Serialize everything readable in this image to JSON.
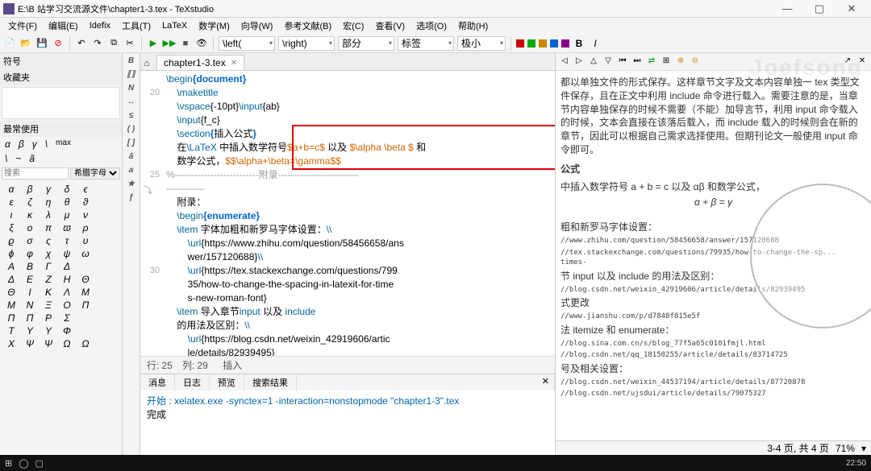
{
  "title": "E:\\B 站学习交流源文件\\chapter1-3.tex - TeXstudio",
  "menus": [
    "文件(F)",
    "编辑(E)",
    "Idefix",
    "工具(T)",
    "LaTeX",
    "数学(M)",
    "向导(W)",
    "参考文献(B)",
    "宏(C)",
    "查看(V)",
    "选项(O)",
    "帮助(H)"
  ],
  "toolbar_dropdowns": [
    "\\left(",
    "\\right)",
    "部分",
    "标签",
    "极小"
  ],
  "left": {
    "symbols_title": "符号",
    "favorites_title": "收藏夹",
    "most_used_title": "最常使用",
    "common1": [
      "α",
      "β",
      "γ",
      "\\",
      "max"
    ],
    "common2": [
      "\\",
      "~",
      "ã"
    ],
    "search_placeholder": "搜索",
    "category": "希腊字母",
    "rows": [
      [
        "α",
        "β",
        "γ",
        "δ",
        "ϵ"
      ],
      [
        "ε",
        "ζ",
        "η",
        "θ",
        "ϑ"
      ],
      [
        "ι",
        "κ",
        "λ",
        "μ",
        "ν"
      ],
      [
        "ξ",
        "ο",
        "π",
        "ϖ",
        "ρ"
      ],
      [
        "ϱ",
        "σ",
        "ς",
        "τ",
        "υ"
      ],
      [
        "ϕ",
        "φ",
        "χ",
        "ψ",
        "ω"
      ],
      [
        "A",
        "B",
        "Γ",
        "Δ",
        ""
      ],
      [
        "Δ",
        "E",
        "Z",
        "H",
        "Θ"
      ],
      [
        "Θ",
        "I",
        "K",
        "Λ",
        "M"
      ],
      [
        "M",
        "N",
        "Ξ",
        "O",
        "Π"
      ],
      [
        "Π",
        "Π",
        "P",
        "Σ",
        ""
      ],
      [
        "T",
        "Υ",
        "Υ",
        "Φ",
        ""
      ],
      [
        "X",
        "Ψ",
        "Ψ",
        "Ω",
        "Ω"
      ]
    ]
  },
  "tab": {
    "name": "chapter1-3.tex"
  },
  "code": {
    "lines": [
      {
        "n": "",
        "t": [
          [
            "cmd",
            "\\begin"
          ],
          [
            "brace",
            "{"
          ],
          [
            "brace",
            "document"
          ],
          [
            "brace",
            "}"
          ]
        ]
      },
      {
        "n": "20",
        "t": [
          [
            "",
            "    "
          ],
          [
            "cmd",
            "\\maketitle"
          ]
        ]
      },
      {
        "n": "",
        "t": [
          [
            "",
            "    "
          ],
          [
            "cmd",
            "\\vspace"
          ],
          [
            "",
            "{-10pt}"
          ],
          [
            "cmd",
            "\\input"
          ],
          [
            "",
            "{ab}"
          ]
        ]
      },
      {
        "n": "",
        "t": [
          [
            "",
            "    "
          ],
          [
            "cmd",
            "\\input"
          ],
          [
            "",
            "{f_c}"
          ]
        ]
      },
      {
        "n": "",
        "t": [
          [
            "",
            "    "
          ],
          [
            "cmd",
            "\\section"
          ],
          [
            "brace",
            "{"
          ],
          [
            "",
            "插入公式"
          ],
          [
            "brace",
            "}"
          ]
        ]
      },
      {
        "n": "",
        "t": [
          [
            "",
            "    在"
          ],
          [
            "cmd",
            "\\LaTeX"
          ],
          [
            "",
            ""
          ],
          [
            "",
            " 中插入数学符号"
          ],
          [
            "math",
            "$a+b=c$"
          ],
          [
            "",
            " 以及 "
          ],
          [
            "math",
            "$\\alpha \\beta $"
          ],
          [
            "",
            " 和"
          ]
        ]
      },
      {
        "n": "",
        "t": [
          [
            "",
            "    数学公式，"
          ],
          [
            "math",
            "$$\\alpha+\\beta=\\gamma$$"
          ]
        ]
      },
      {
        "n": "25",
        "t": [
          [
            "comment",
            "%--------------------------附录-------------------------"
          ]
        ]
      },
      {
        "n": "",
        "t": [
          [
            "comment",
            "------------"
          ]
        ]
      },
      {
        "n": "",
        "t": [
          [
            "",
            "    附录："
          ]
        ]
      },
      {
        "n": "",
        "t": [
          [
            "",
            "    "
          ],
          [
            "cmd",
            "\\begin"
          ],
          [
            "brace",
            "{"
          ],
          [
            "brace",
            "enumerate"
          ],
          [
            "brace",
            "}"
          ]
        ]
      },
      {
        "n": "",
        "t": [
          [
            "",
            "    "
          ],
          [
            "cmd",
            "\\item"
          ],
          [
            "",
            " 字体加粗和新罗马字体设置："
          ],
          [
            "cmd",
            "\\\\"
          ]
        ]
      },
      {
        "n": "",
        "t": [
          [
            "",
            "        "
          ],
          [
            "cmd",
            "\\url"
          ],
          [
            "",
            "{https://www.zhihu.com/question/58456658/ans"
          ]
        ]
      },
      {
        "n": "",
        "t": [
          [
            "",
            "        wer/157120688}"
          ],
          [
            "cmd",
            "\\\\"
          ]
        ]
      },
      {
        "n": "30",
        "t": [
          [
            "",
            "        "
          ],
          [
            "cmd",
            "\\url"
          ],
          [
            "",
            "{https://tex.stackexchange.com/questions/799"
          ]
        ]
      },
      {
        "n": "",
        "t": [
          [
            "",
            "        35/how-to-change-the-spacing-in-latexit-for-time"
          ]
        ]
      },
      {
        "n": "",
        "t": [
          [
            "",
            "        s-new-roman-font}"
          ]
        ]
      },
      {
        "n": "",
        "t": [
          [
            "",
            "    "
          ],
          [
            "cmd",
            "\\item"
          ],
          [
            "",
            " 导入章节"
          ],
          [
            "cmd",
            "input"
          ],
          [
            "",
            " 以及 "
          ],
          [
            "cmd",
            "include"
          ]
        ]
      },
      {
        "n": "",
        "t": [
          [
            "",
            "    的用法及区别："
          ],
          [
            "cmd",
            "\\\\"
          ]
        ]
      },
      {
        "n": "",
        "t": [
          [
            "",
            "        "
          ],
          [
            "cmd",
            "\\url"
          ],
          [
            "",
            "{https://blog.csdn.net/weixin_42919606/artic"
          ]
        ]
      },
      {
        "n": "",
        "t": [
          [
            "",
            "        le/details/82939495}"
          ]
        ]
      }
    ]
  },
  "status": {
    "row_label": "行:",
    "row": "25",
    "col_label": "列:",
    "col": "29",
    "mode": "插入"
  },
  "log": {
    "tabs": [
      "消息",
      "日志",
      "预览",
      "搜索结果"
    ],
    "cmd": "开始 : xelatex.exe -synctex=1 -interaction=nonstopmode \"chapter1-3\".tex",
    "done": "完成"
  },
  "preview": {
    "para1": "都以单独文件的形式保存。这样章节文字及文本内容单独一 tex 类型文件保存，且在正文中利用 include 命令进行载入。需要注意的是，当章节内容单独保存的时候不需要（不能）加导言节，利用 input 命令载入的时候，文本会直接在该落后载入，而 include 载入的时候则会在新的章节，因此可以根据自己需求选择使用。但期刊论文一般使用 input 命令即可。",
    "heading": "公式",
    "para2": "中插入数学符号 a + b = c 以及 αβ 和数学公式，",
    "formula": "α + β = γ",
    "items": [
      {
        "h": "粗和新罗马字体设置：",
        "u": [
          "//www.zhihu.com/question/58456658/answer/157120688",
          "//tex.stackexchange.com/questions/79935/how-to-change-the-sp...    times-"
        ]
      },
      {
        "h": "节 input 以及 include 的用法及区别：",
        "u": [
          "//blog.csdn.net/weixin_42919606/article/details/82939495"
        ]
      },
      {
        "h": "式更改",
        "u": [
          "//www.jianshu.com/p/d7848f815e5f"
        ]
      },
      {
        "h": "法 itemize 和 enumerate：",
        "u": [
          "//blog.sina.com.cn/s/blog_77f5a65c0101fmjl.html",
          "//blog.csdn.net/qq_18150255/article/details/83714725"
        ]
      },
      {
        "h": "号及相关设置：",
        "u": [
          "//blog.csdn.net/weixin_44537194/article/details/87720878",
          "//blog.csdn.net/ujsdui/article/details/79075327"
        ]
      }
    ]
  },
  "right_status": {
    "pages": "3-4 页, 共 4 页",
    "zoom": "71%"
  },
  "taskbar": {
    "time": "22:50"
  },
  "watermark": "Joefsong"
}
